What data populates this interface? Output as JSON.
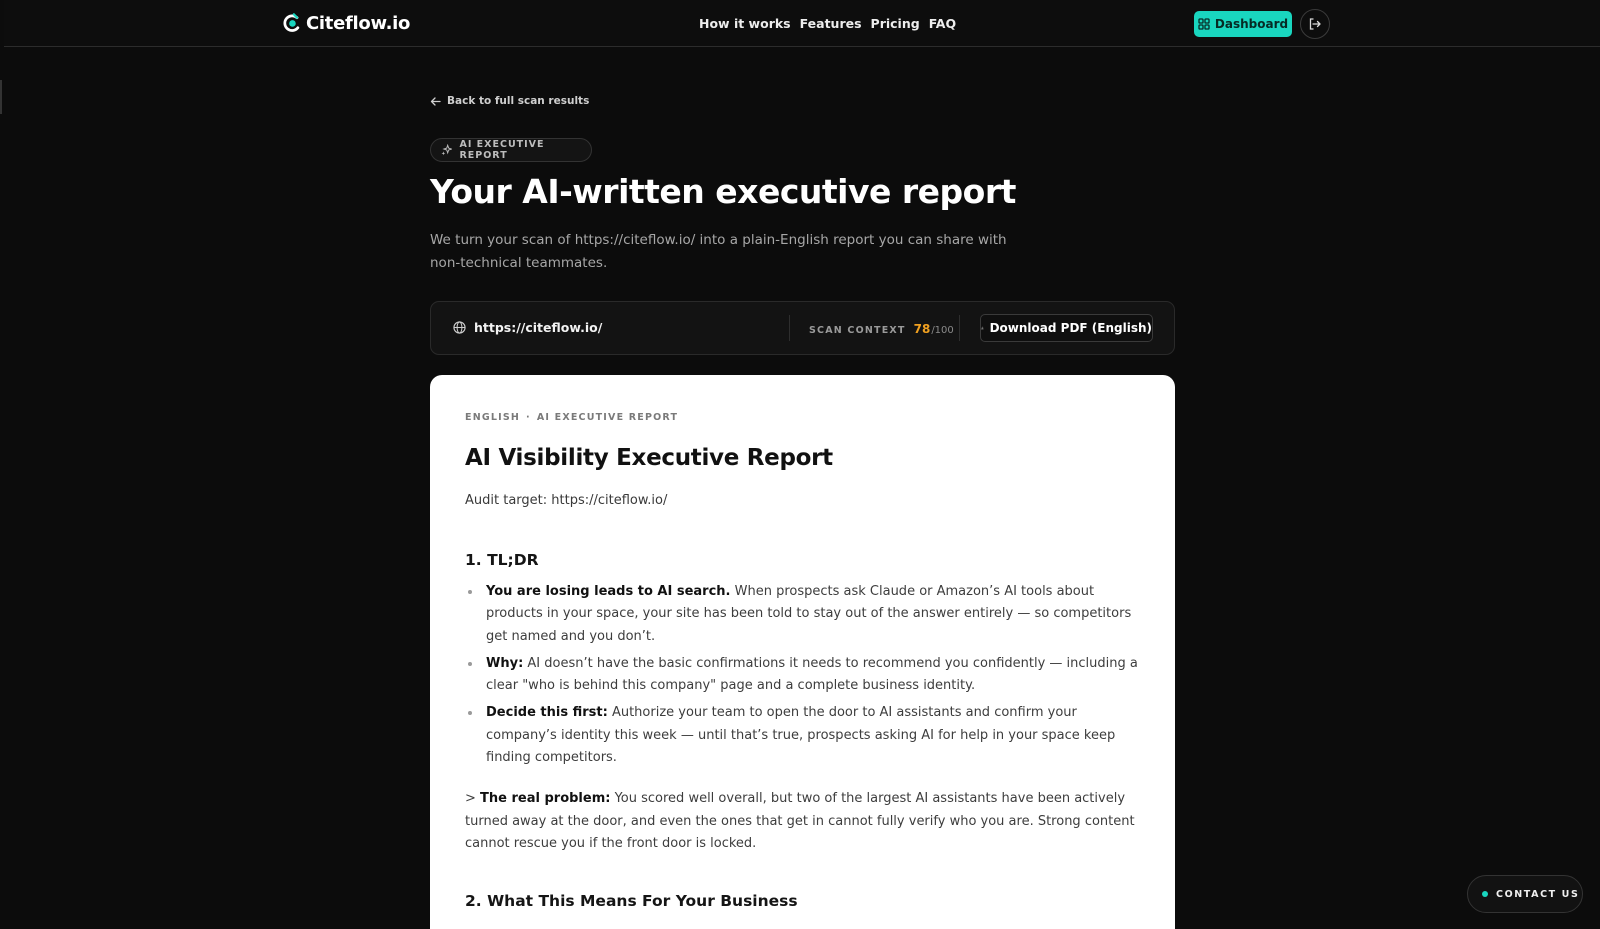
{
  "header": {
    "brand": "Citeflow.io",
    "nav": [
      "How it works",
      "Features",
      "Pricing",
      "FAQ"
    ],
    "dashboard_label": "Dashboard",
    "accent_color": "#19d6bf"
  },
  "back_link": "Back to full scan results",
  "badge": "AI EXECUTIVE REPORT",
  "page_title": "Your AI-written executive report",
  "page_subtitle": "We turn your scan of https://citeflow.io/ into a plain-English report you can share with non-technical teammates.",
  "info_bar": {
    "url": "https://citeflow.io/",
    "scan_label": "SCAN CONTEXT",
    "score": "78",
    "score_max": "/100",
    "score_color": "#f0a020",
    "download_label": "Download PDF (English)"
  },
  "report": {
    "language": "ENGLISH",
    "meta_sep": "·",
    "kind": "AI EXECUTIVE REPORT",
    "title": "AI Visibility Executive Report",
    "audit_target": "Audit target: https://citeflow.io/",
    "section1": "1. TL;DR",
    "bullets": [
      {
        "lead": "You are losing leads to AI search.",
        "text": " When prospects ask Claude or Amazon’s AI tools about products in your space, your site has been told to stay out of the answer entirely — so competitors get named and you don’t."
      },
      {
        "lead": "Why:",
        "text": " AI doesn’t have the basic confirmations it needs to recommend you confidently — including a clear \"who is behind this company\" page and a complete business identity."
      },
      {
        "lead": "Decide this first:",
        "text": " Authorize your team to open the door to AI assistants and confirm your company’s identity this week — until that’s true, prospects asking AI for help in your space keep finding competitors."
      }
    ],
    "problem_prefix": "> ",
    "problem_lead": "The real problem:",
    "problem_text": " You scored well overall, but two of the largest AI assistants have been actively turned away at the door, and even the ones that get in cannot fully verify who you are. Strong content cannot rescue you if the front door is locked.",
    "section2": "2. What This Means For Your Business"
  },
  "contact_label": "CONTACT US",
  "icons": [
    "citeflow-logo",
    "dashboard-grid-icon",
    "logout-icon",
    "arrow-left-icon",
    "sparkles-icon",
    "globe-icon",
    "download-icon"
  ]
}
